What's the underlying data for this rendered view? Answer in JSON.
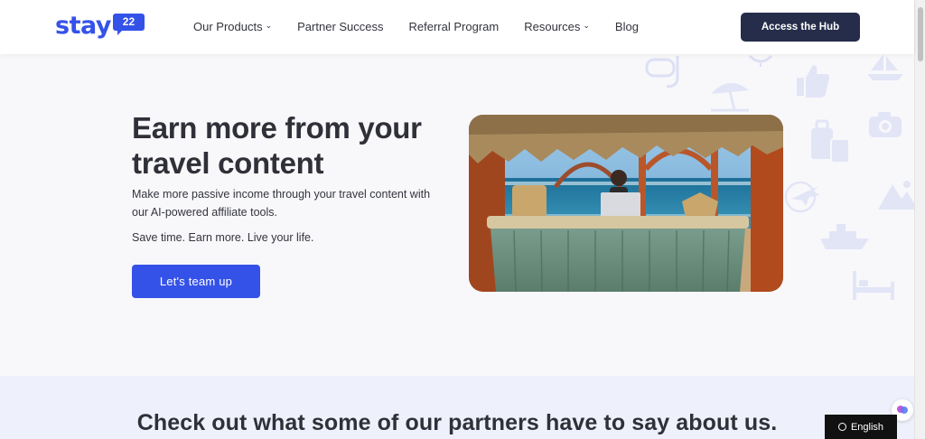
{
  "brand": {
    "name": "stay",
    "badge": "22",
    "accent": "#3552e8",
    "dark_button": "#262d4a"
  },
  "nav": {
    "items": [
      {
        "label": "Our Products",
        "has_dropdown": true
      },
      {
        "label": "Partner Success",
        "has_dropdown": false
      },
      {
        "label": "Referral Program",
        "has_dropdown": false
      },
      {
        "label": "Resources",
        "has_dropdown": true
      },
      {
        "label": "Blog",
        "has_dropdown": false
      }
    ],
    "hub_button": "Access the Hub"
  },
  "hero": {
    "title": "Earn more from your travel content",
    "description": "Make more passive income through your travel content with our AI-powered affiliate tools.",
    "tagline": "Save time. Earn more. Live your life.",
    "cta": "Let's team up"
  },
  "icons": [
    "snorkel-mask-icon",
    "beach-umbrella-icon",
    "thumbs-up-icon",
    "sailboat-icon",
    "camera-icon",
    "luggage-icon",
    "airplane-icon",
    "mountains-icon",
    "cruise-ship-icon",
    "bed-icon",
    "sun-icon",
    "chevron-down-icon",
    "globe-icon",
    "chat-icon"
  ],
  "partners": {
    "heading": "Check out what some of our partners have to say about us."
  },
  "language": {
    "label": "English"
  }
}
